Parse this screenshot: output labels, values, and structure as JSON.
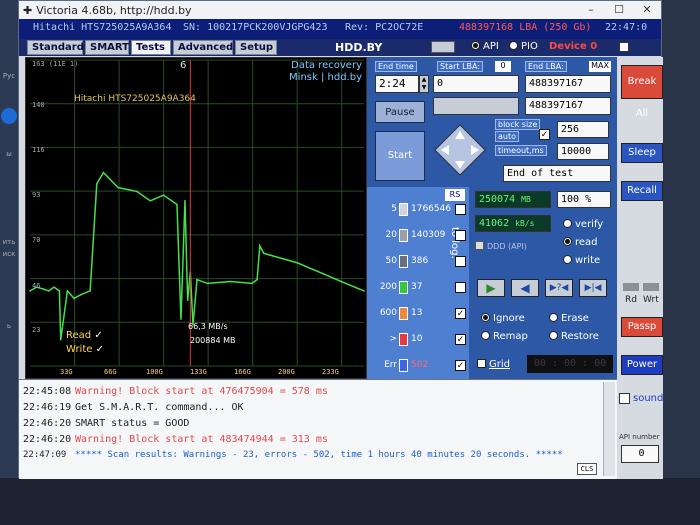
{
  "window": {
    "title": "Victoria 4.68b, http://hdd.by"
  },
  "info": {
    "drive_model": "Hitachi HTS725025A9A364",
    "serial": "SN: 100217PCK200VJGPG423",
    "firmware": "Rev: PC2OC72E",
    "capacity": "488397168 LBA (250 Gb)",
    "clock": "22:47:0"
  },
  "tabs": [
    "Standard",
    "SMART",
    "Tests",
    "Advanced",
    "Setup"
  ],
  "brand": "HDD.BY",
  "api_mode": {
    "api": "API",
    "pio": "PIO",
    "device": "Device 0"
  },
  "graph": {
    "counter": "6",
    "recovery_line1": "Data recovery",
    "recovery_line2": "Minsk | hdd.by",
    "drive_label": "Hitachi HTS725025A9A364",
    "y_labels": [
      "163 (11E 1)",
      "140",
      "116",
      "93",
      "70",
      "46",
      "23"
    ],
    "x_labels": [
      "33G",
      "66G",
      "100G",
      "133G",
      "166G",
      "200G",
      "233G"
    ],
    "speed_label": "66,3 MB/s",
    "pos_label": "200884 MB",
    "read_label": "Read",
    "write_label": "Write"
  },
  "chart_data": {
    "type": "line",
    "title": "",
    "xlabel": "",
    "ylabel": "",
    "ylim": [
      0,
      163
    ],
    "series": [
      {
        "name": "Read",
        "x": [
          0,
          5,
          10,
          14,
          18,
          22,
          23,
          28,
          33,
          38,
          45,
          50,
          55,
          66,
          80,
          90,
          100,
          110,
          113,
          116,
          118,
          120,
          122,
          125,
          133,
          150,
          166,
          170,
          172,
          175,
          180,
          190,
          200,
          210,
          220,
          233,
          250
        ],
        "values": [
          40,
          42,
          41,
          40,
          42,
          40,
          14,
          40,
          36,
          38,
          40,
          97,
          103,
          95,
          93,
          88,
          91,
          86,
          25,
          88,
          35,
          50,
          22,
          46,
          44,
          45,
          44,
          46,
          64,
          60,
          59,
          57,
          55,
          52,
          49,
          45,
          40
        ]
      }
    ]
  },
  "controls": {
    "end_time_label": "End time",
    "start_lba_label": "Start LBA:",
    "start_lba_btn": "0",
    "end_lba_label": "End LBA:",
    "end_lba_btn": "MAX",
    "time_value": "2:24",
    "start_lba_value": "0",
    "end_lba_value": "488397167",
    "cur_lba_value": "488397167",
    "pause": "Pause",
    "start": "Start",
    "block_size_label": "block size",
    "auto_label": "auto",
    "block_size_value": "256",
    "timeout_label": "timeout,ms",
    "timeout_value": "10000",
    "end_action": "End of test",
    "break_all": "Break All"
  },
  "stats": {
    "rs": "RS",
    "to_log": "to log:",
    "rows": [
      {
        "label": "5",
        "count": "1766546",
        "color": "#d0d4d8",
        "checked": ""
      },
      {
        "label": "20",
        "count": "140309",
        "color": "#9aa0a6",
        "checked": ""
      },
      {
        "label": "50",
        "count": "386",
        "color": "#6b7076",
        "checked": ""
      },
      {
        "label": "200",
        "count": "37",
        "color": "#35c83a",
        "checked": ""
      },
      {
        "label": "600",
        "count": "13",
        "color": "#f08a3a",
        "checked": "✓"
      },
      {
        "label": ">",
        "count": "10",
        "color": "#e83a3a",
        "checked": "✓"
      },
      {
        "label": "Err",
        "count": "502",
        "color": "#3a66e0",
        "checked": "✓"
      }
    ]
  },
  "speed": {
    "position": "250074",
    "position_unit": "MB",
    "percent": "100",
    "percent_unit": "%",
    "speed": "41062",
    "speed_unit": "kB/s",
    "ddd": "DDD (API)",
    "verify": "verify",
    "read": "read",
    "write": "write",
    "ignore": "Ignore",
    "erase": "Erase",
    "remap": "Remap",
    "restore": "Restore",
    "grid": "Grid",
    "timer": "00 : 00 : 00"
  },
  "sidebar": {
    "sleep": "Sleep",
    "recall": "Recall",
    "rd": "Rd",
    "wrt": "Wrt",
    "passp": "Passp",
    "power": "Power",
    "sound": "sound",
    "api_number_label": "API number",
    "api_number": "0"
  },
  "log": [
    {
      "time": "22:45:08",
      "text": "Warning! Block start at 476475904 = 578 ms",
      "kind": "w"
    },
    {
      "time": "22:46:19",
      "text": "Get S.M.A.R.T. command... OK",
      "kind": "n"
    },
    {
      "time": "22:46:20",
      "text": "SMART status = GOOD",
      "kind": "n"
    },
    {
      "time": "22:46:20",
      "text": "Warning! Block start at 483474944 = 313 ms",
      "kind": "w"
    },
    {
      "time": "22:47:09",
      "text": "***** Scan results: Warnings - 23, errors - 502, time 1 hours 40 minutes 20 seconds. *****",
      "kind": "b"
    }
  ],
  "log_cls": "CLS",
  "desktop_labels": [
    "Рус",
    "ить",
    "иск",
    "ь",
    "ы"
  ]
}
